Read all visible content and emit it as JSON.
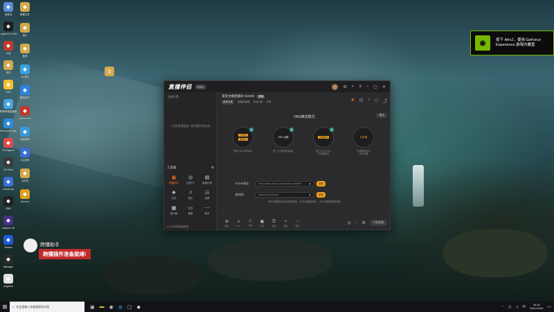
{
  "desktop": {
    "icons": [
      {
        "label": "回收站",
        "icon": "recycle-bin-icon",
        "color": "#5a8fd8"
      },
      {
        "label": "Logitech G HUB",
        "icon": "logitech-icon",
        "color": "#1c1c1c"
      },
      {
        "label": "大笑",
        "icon": "app-icon",
        "color": "#c0392b"
      },
      {
        "label": "脚本",
        "icon": "folder-icon",
        "color": "#d4a84a"
      },
      {
        "label": "KMS",
        "icon": "app-icon",
        "color": "#f2c12e"
      },
      {
        "label": "哔哩哔哩直播姬",
        "icon": "bilibili-icon",
        "color": "#4aa3df"
      },
      {
        "label": "Microsoft Edge",
        "icon": "edge-icon",
        "color": "#2d8ad8"
      },
      {
        "label": "EVCapture",
        "icon": "app-icon",
        "color": "#e04a4a"
      },
      {
        "label": "4K Video",
        "icon": "app-icon",
        "color": "#3a3a3a"
      },
      {
        "label": "GameCap",
        "icon": "app-icon",
        "color": "#3a6fd8"
      },
      {
        "label": "OBS",
        "icon": "obs-icon",
        "color": "#222"
      },
      {
        "label": "Capture HD",
        "icon": "capture-icon",
        "color": "#4a2f8a"
      },
      {
        "label": "Stream",
        "icon": "app-icon",
        "color": "#1e5ad8"
      },
      {
        "label": "Manager",
        "icon": "app-icon",
        "color": "#2a2a2a"
      },
      {
        "label": "Anydesk",
        "icon": "app-icon",
        "color": "#e0e0e0"
      }
    ],
    "col2": [
      {
        "label": "新建文件",
        "icon": "file-icon",
        "color": "#d4a84a"
      },
      {
        "label": "图片",
        "icon": "image-icon",
        "color": "#d4a84a"
      },
      {
        "label": "截图",
        "icon": "image-icon",
        "color": "#d4a84a"
      },
      {
        "label": "QQ音乐",
        "icon": "app-icon",
        "color": "#3aa0e0"
      },
      {
        "label": "酷狗音乐",
        "icon": "kugou-icon",
        "color": "#2a86e0"
      },
      {
        "label": "Afterburner",
        "icon": "app-icon",
        "color": "#c0392b"
      },
      {
        "label": "电脑管家",
        "icon": "app-icon",
        "color": "#3a9ad8"
      },
      {
        "label": "QQ游戏",
        "icon": "app-icon",
        "color": "#3a6fd8"
      },
      {
        "label": "文件夹",
        "icon": "folder-icon",
        "color": "#d4a84a"
      },
      {
        "label": "Chrome",
        "icon": "chrome-icon",
        "color": "#e0a020"
      }
    ]
  },
  "geforce_toast": {
    "line1": "按下 Alt+Z，使用 GeForce",
    "line2": "Experience 游戏内覆盖",
    "accent": "#76b900"
  },
  "app": {
    "brand": "直播伴侣",
    "version": "PRO",
    "sidebar": {
      "tab_left": "直播设置",
      "tab_right": "",
      "empty_text": "+ 添加直播画面 / 拖动素材到此处",
      "section_title": "工具箱",
      "tools": [
        {
          "label": "跨播插件",
          "icon": "plugin-icon",
          "active": true
        },
        {
          "label": "连麦PK",
          "icon": "mic-icon",
          "active": false
        },
        {
          "label": "直播记录",
          "icon": "record-icon",
          "active": false
        },
        {
          "label": "礼物",
          "icon": "gift-icon",
          "active": false
        },
        {
          "label": "音乐",
          "icon": "music-icon",
          "active": false
        },
        {
          "label": "投票",
          "icon": "vote-icon",
          "active": false
        },
        {
          "label": "画中画",
          "icon": "pip-icon",
          "active": false
        },
        {
          "label": "弹幕",
          "icon": "chat-icon",
          "active": false
        },
        {
          "label": "更多",
          "icon": "more-icon",
          "active": false
        }
      ],
      "bottom_text": "点击查看直播数据"
    },
    "header": {
      "room_name": "某某主播直播间 NI3300",
      "tag": "直播",
      "category": "选择分类",
      "meta1": "直播间标题",
      "meta2": "在线人数",
      "meta3": "分享"
    },
    "mode_title": "OBS推流模式",
    "exit_label": "退出",
    "steps": [
      {
        "pill1": "已开启",
        "pill2": "推流中",
        "text": "",
        "desc": "配置 OBS 推流地址"
      },
      {
        "pill1": "",
        "pill2": "",
        "text": "OBS 设置",
        "desc": "第二步 填写推流地址"
      },
      {
        "pill1": "开始推流",
        "pill2": "",
        "text": "",
        "desc": "第三步 在 OBS\n中开始推流"
      },
      {
        "pill1": "",
        "pill2": "",
        "text": "去开播",
        "desc": "在直播伴侣中\n点击开播"
      }
    ],
    "fields": [
      {
        "label": "RTMP地址",
        "value": "rtmp://push-rtmp-l3.douyincdn.com/third",
        "copy": "复制"
      },
      {
        "label": "推流码",
        "value": "stream-xxxxxxxxxx",
        "copy": "复制"
      }
    ],
    "hint": "请勿泄露推流地址和推流码，仅本次直播有效，下次开播需重新获取",
    "bottom_tools": [
      {
        "label": "连麦",
        "icon": "link-icon"
      },
      {
        "label": "PK",
        "icon": "pk-icon"
      },
      {
        "label": "互动",
        "icon": "interact-icon"
      },
      {
        "label": "玩法",
        "icon": "game-icon"
      },
      {
        "label": "任务",
        "icon": "task-icon"
      },
      {
        "label": "美颜",
        "icon": "beauty-icon"
      },
      {
        "label": "更多",
        "icon": "more-icon"
      }
    ],
    "live_button": "开始直播"
  },
  "notification": {
    "title": "跨播助手",
    "message": "跨播插件准备就绪!"
  },
  "taskbar": {
    "search_placeholder": "在这里输入你要搜索的内容",
    "time": "09:16",
    "date": "2021/10/29"
  }
}
